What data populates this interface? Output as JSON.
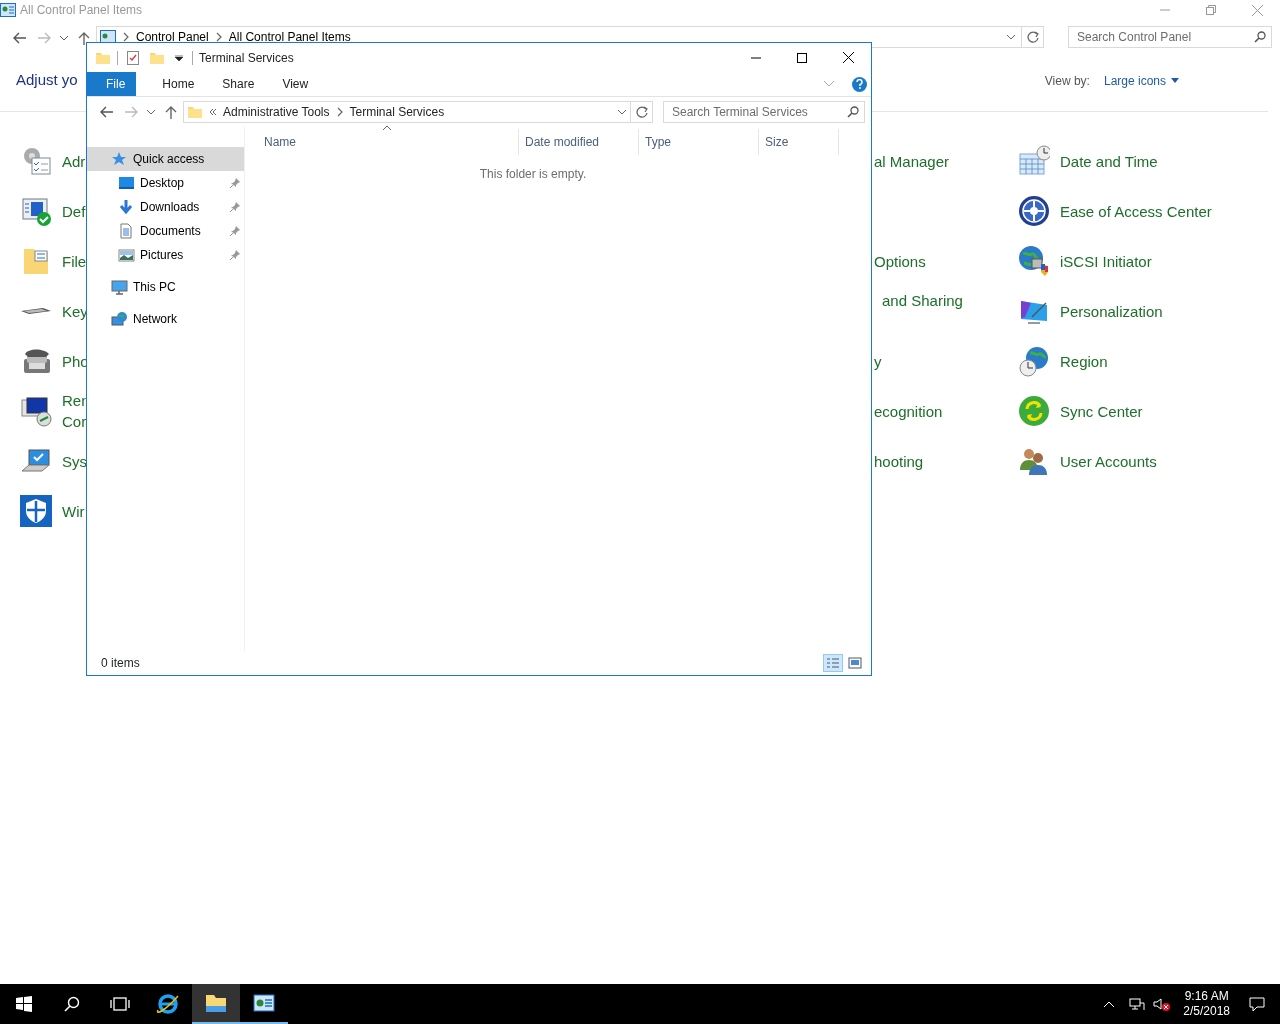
{
  "control_panel": {
    "title": "All Control Panel Items",
    "breadcrumb": [
      "Control Panel",
      "All Control Panel Items"
    ],
    "search": {
      "placeholder": "Search Control Panel"
    },
    "heading": "Adjust yo",
    "view_by": {
      "label": "View by:",
      "value": "Large icons"
    },
    "items_left": [
      {
        "label": "Adr",
        "kind": "admin"
      },
      {
        "label": "Def",
        "kind": "defender"
      },
      {
        "label": "File",
        "kind": "filehistory"
      },
      {
        "label": "Key",
        "kind": "keyboard"
      },
      {
        "label": "Pho",
        "kind": "phone"
      },
      {
        "label": "Ren\nCor",
        "kind": "remote"
      },
      {
        "label": "Sys",
        "kind": "system"
      },
      {
        "label": "Wir",
        "kind": "firewall"
      }
    ],
    "items_middle": [
      {
        "label": "al Manager"
      },
      {
        "label": "Options"
      },
      {
        "label": "and Sharing"
      },
      {
        "label": "y"
      },
      {
        "label": "ecognition"
      },
      {
        "label": "hooting"
      }
    ],
    "items_right": [
      {
        "label": "Date and Time",
        "kind": "datetime"
      },
      {
        "label": "Ease of Access Center",
        "kind": "ease"
      },
      {
        "label": "iSCSI Initiator",
        "kind": "iscsi"
      },
      {
        "label": "Personalization",
        "kind": "personalization"
      },
      {
        "label": "Region",
        "kind": "region"
      },
      {
        "label": "Sync Center",
        "kind": "sync"
      },
      {
        "label": "User Accounts",
        "kind": "users"
      }
    ]
  },
  "explorer": {
    "title": "Terminal Services",
    "ribbon_tabs": [
      {
        "label": "File",
        "kind": "file"
      },
      {
        "label": "Home",
        "kind": "tab"
      },
      {
        "label": "Share",
        "kind": "tab"
      },
      {
        "label": "View",
        "kind": "tab"
      }
    ],
    "path": [
      "Administrative Tools",
      "Terminal Services"
    ],
    "search": {
      "placeholder": "Search Terminal Services"
    },
    "nav": [
      {
        "label": "Quick access",
        "kind": "quick",
        "selected": true,
        "children": [
          {
            "label": "Desktop",
            "kind": "desktop",
            "pinned": true,
            "selected": false
          },
          {
            "label": "Downloads",
            "kind": "downloads",
            "pinned": true,
            "selected": false
          },
          {
            "label": "Documents",
            "kind": "documents",
            "pinned": true,
            "selected": false
          },
          {
            "label": "Pictures",
            "kind": "pictures",
            "pinned": true,
            "selected": false
          }
        ]
      },
      {
        "label": "This PC",
        "kind": "pc",
        "selected": false
      },
      {
        "label": "Network",
        "kind": "network",
        "selected": false
      }
    ],
    "columns": [
      "Name",
      "Date modified",
      "Type",
      "Size"
    ],
    "empty_message": "This folder is empty.",
    "status": "0 items",
    "views": [
      {
        "kind": "details",
        "selected": true
      },
      {
        "kind": "large",
        "selected": false
      }
    ]
  },
  "taskbar": {
    "apps": [
      {
        "kind": "ie",
        "active": false,
        "running": false
      },
      {
        "kind": "explorer",
        "active": true,
        "running": true
      },
      {
        "kind": "control",
        "active": false,
        "running": true
      }
    ],
    "time": "9:16 AM",
    "date": "2/5/2018"
  }
}
